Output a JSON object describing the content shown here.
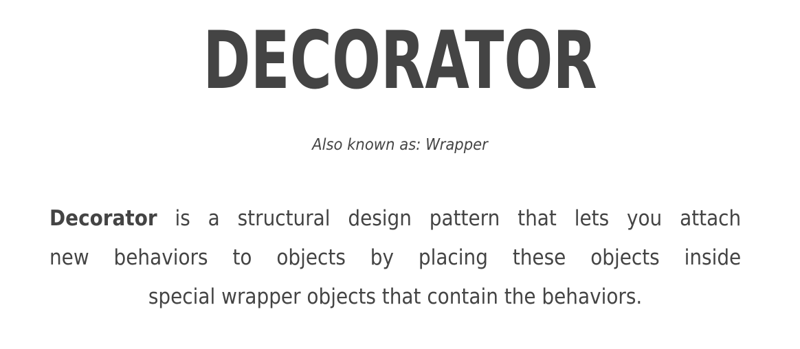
{
  "title": "DECORATOR",
  "also_known_as": "Also known as: Wrapper",
  "intro": {
    "term": "Decorator",
    "line1_rest": " is a structural design pattern that lets you attach",
    "line2": "new behaviors to objects by placing these objects inside",
    "line3": "special wrapper objects that contain the behaviors."
  },
  "colors": {
    "text": "#444444",
    "background": "#ffffff"
  }
}
